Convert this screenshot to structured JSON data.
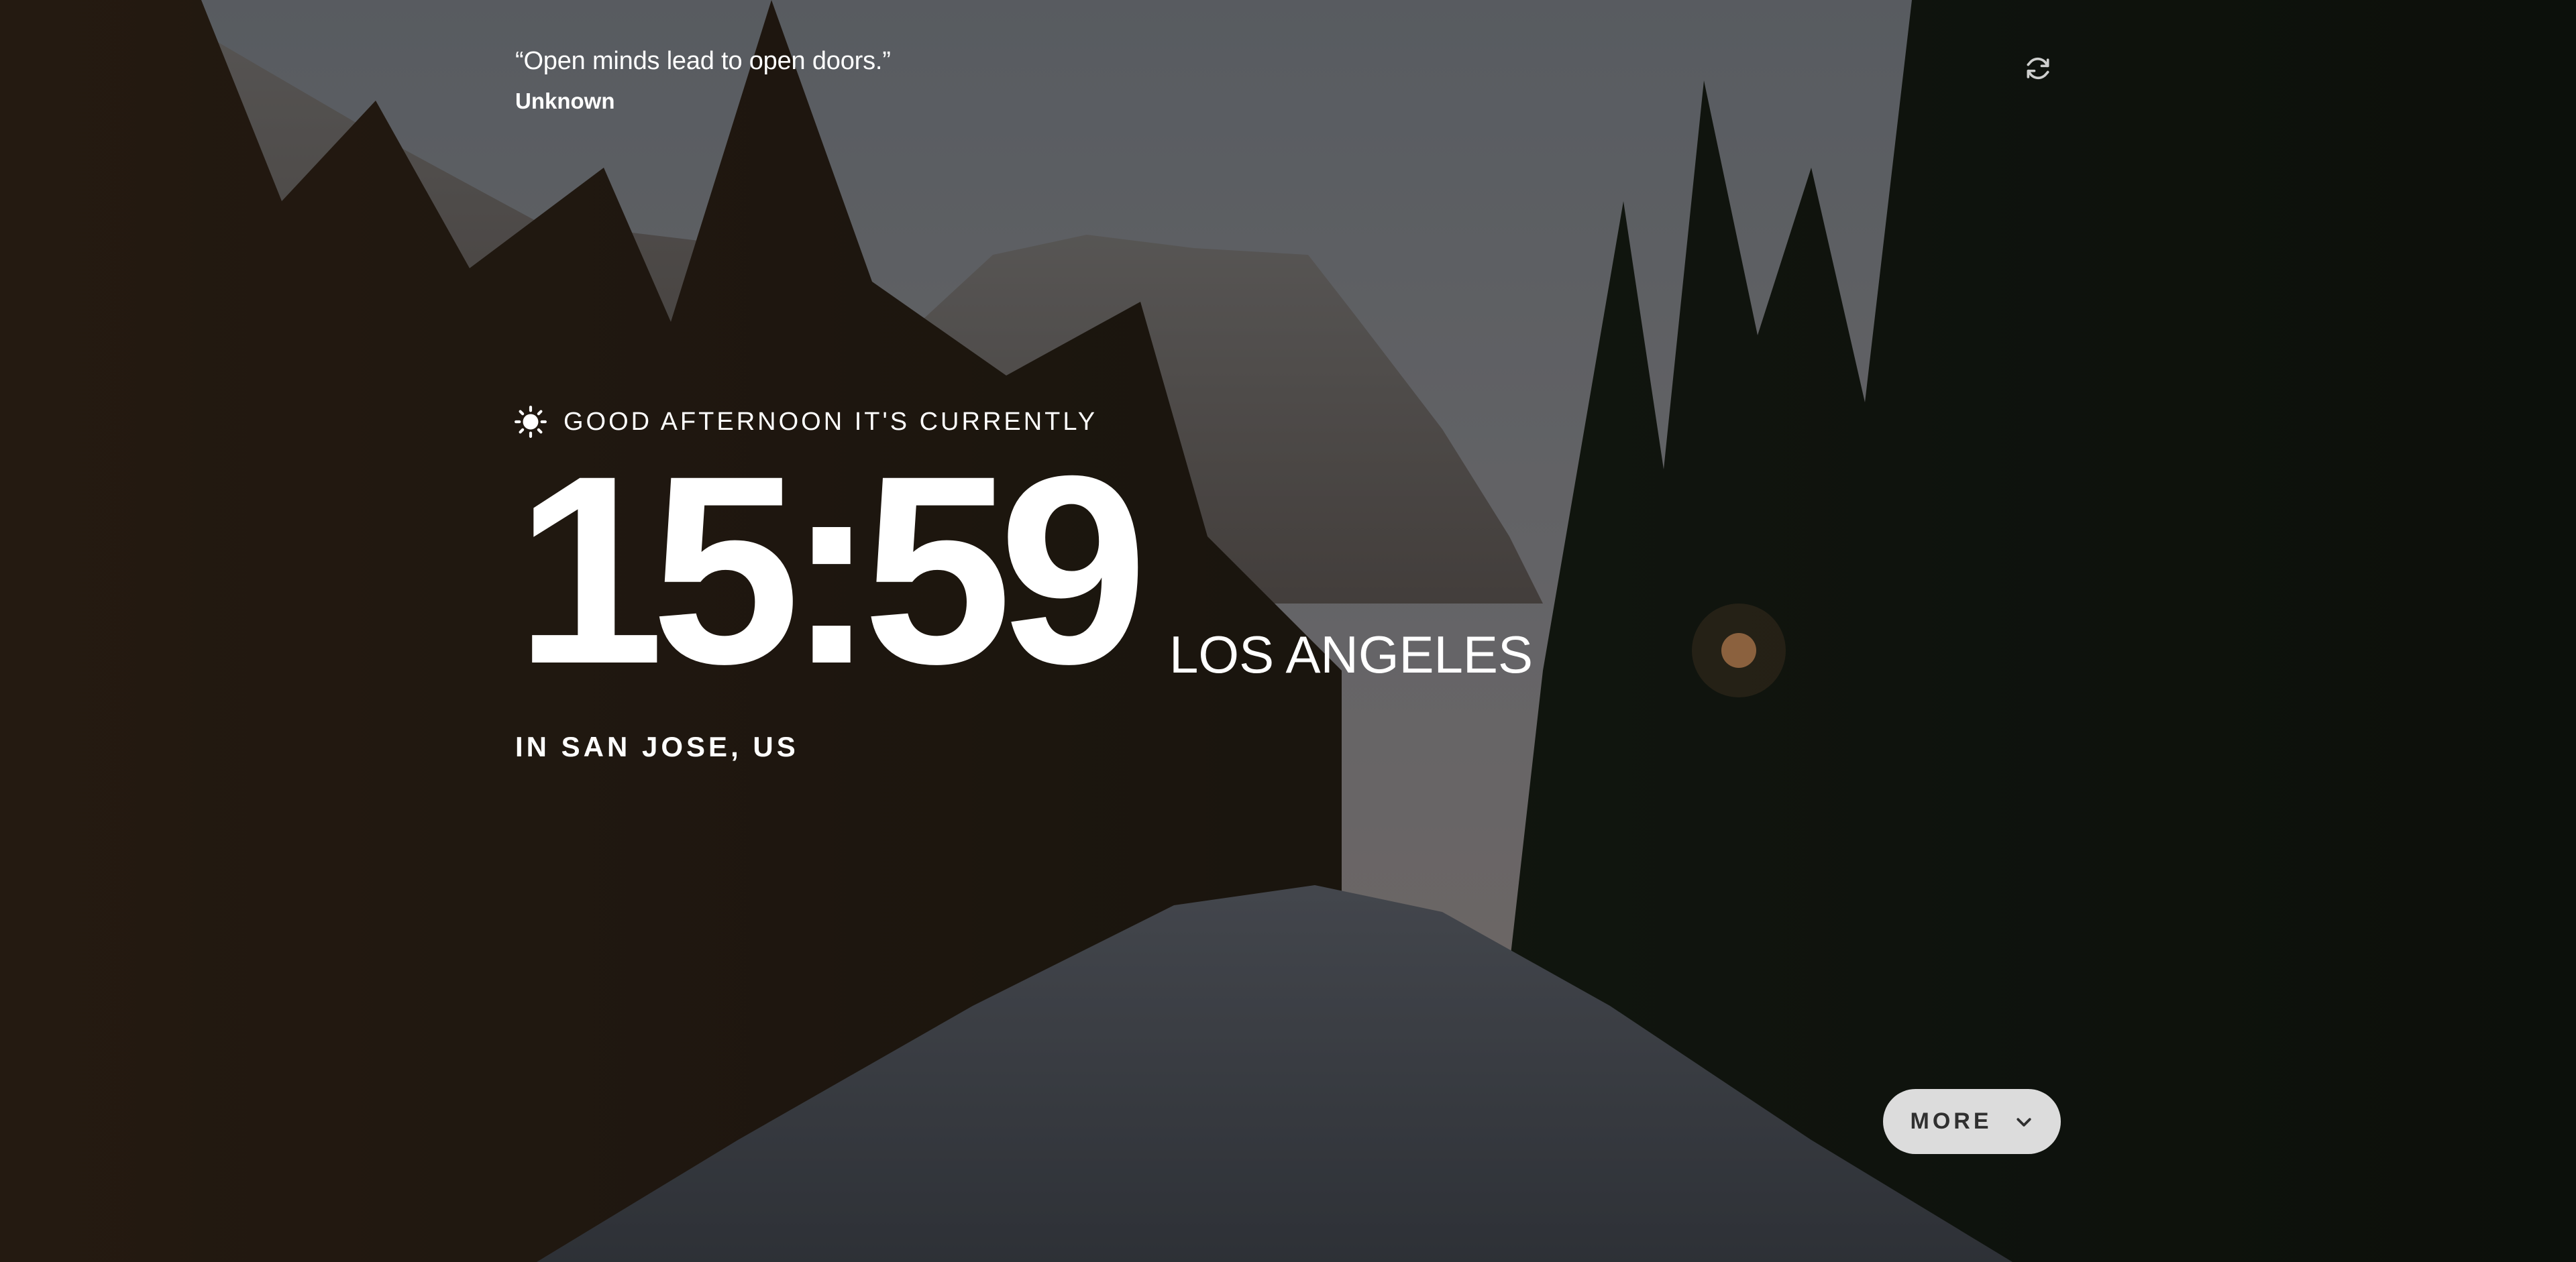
{
  "quote": {
    "text": "“Open minds lead to open doors.”",
    "author": "Unknown"
  },
  "greeting": {
    "icon": "sun-icon",
    "text": "GOOD AFTERNOON IT'S CURRENTLY"
  },
  "clock": {
    "time": "15:59",
    "timezone": "LOS ANGELES"
  },
  "location": {
    "text": "IN SAN JOSE, US"
  },
  "controls": {
    "refresh_icon": "refresh-icon",
    "more_label": "MORE",
    "more_icon": "chevron-down-icon"
  },
  "colors": {
    "text": "#ffffff",
    "button_bg": "#dcdcdc",
    "button_text": "#303030"
  }
}
